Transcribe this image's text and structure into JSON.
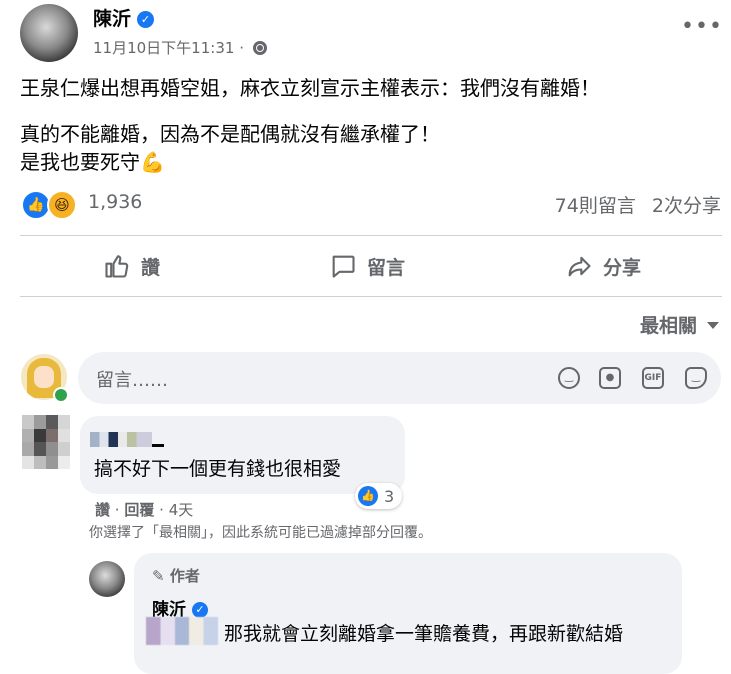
{
  "post": {
    "author": "陳沂",
    "timestamp": "11月10日下午11:31",
    "privacy_icon": "globe-icon",
    "more_label": "•••",
    "text": {
      "line1": "王泉仁爆出想再婚空姐，麻衣立刻宣示主權表示：我們沒有離婚！",
      "line2": "真的不能離婚，因為不是配偶就沒有繼承權了！",
      "line3": "是我也要死守💪"
    },
    "reactions": {
      "icons": [
        "like-icon",
        "haha-icon"
      ],
      "count": "1,936",
      "comments": "74則留言",
      "shares": "2次分享"
    },
    "actions": {
      "like": "讚",
      "comment": "留言",
      "share": "分享"
    }
  },
  "comments_section": {
    "sort_label": "最相關",
    "input_placeholder": "留言……",
    "input_icons": [
      "emoji-icon",
      "camera-icon",
      "gif-icon",
      "sticker-icon"
    ],
    "gif_text": "GIF",
    "comment": {
      "text": "搞不好下一個更有錢也很相愛",
      "like_count": "3",
      "like": "讚",
      "reply": "回覆",
      "age": "4天"
    },
    "filter_note": "你選擇了「最相關」，因此系統可能已過濾掉部分回覆。",
    "reply": {
      "badge": "作者",
      "author": "陳沂",
      "text": "那我就會立刻離婚拿一筆贍養費，再跟新歡結婚"
    }
  },
  "colors": {
    "accent": "#1877f2",
    "secondary_text": "#65676b",
    "bubble_bg": "#f0f2f5",
    "online": "#31a24c"
  }
}
